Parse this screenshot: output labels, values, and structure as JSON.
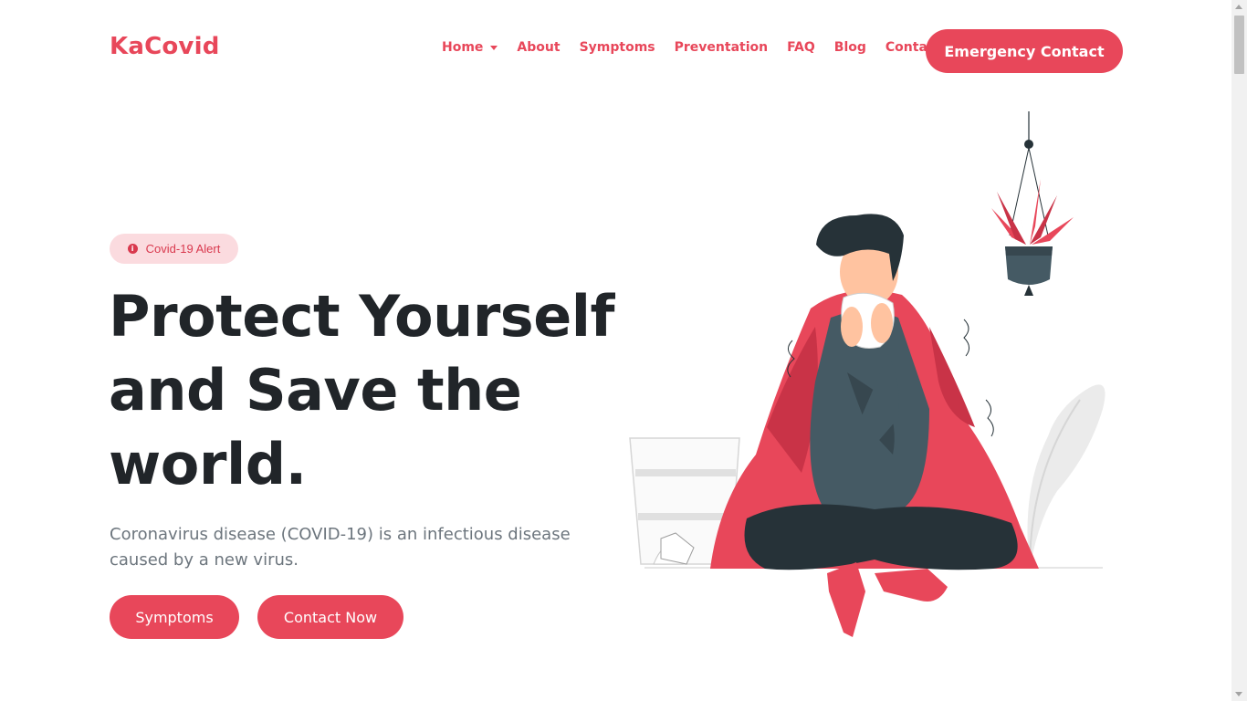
{
  "brand": {
    "name": "KaCovid",
    "color": "#e8475a"
  },
  "nav": {
    "items": [
      {
        "label": "Home",
        "has_dropdown": true
      },
      {
        "label": "About"
      },
      {
        "label": "Symptoms"
      },
      {
        "label": "Preventation"
      },
      {
        "label": "FAQ"
      },
      {
        "label": "Blog"
      },
      {
        "label": "Contact"
      }
    ],
    "cta_label": "Emergency Contact"
  },
  "hero": {
    "badge": {
      "icon": "info-icon",
      "label": "Covid-19 Alert"
    },
    "headline": "Protect Yourself and Save the world.",
    "subtext": "Coronavirus disease (COVID-19) is an infectious disease caused by a new virus.",
    "buttons": {
      "primary": "Symptoms",
      "secondary": "Contact Now"
    },
    "illustration": "sick-person-sneezing-with-blanket"
  },
  "colors": {
    "accent": "#e8475a",
    "badge_bg": "#fbdbdf",
    "heading": "#212529",
    "muted": "#6c757d"
  }
}
